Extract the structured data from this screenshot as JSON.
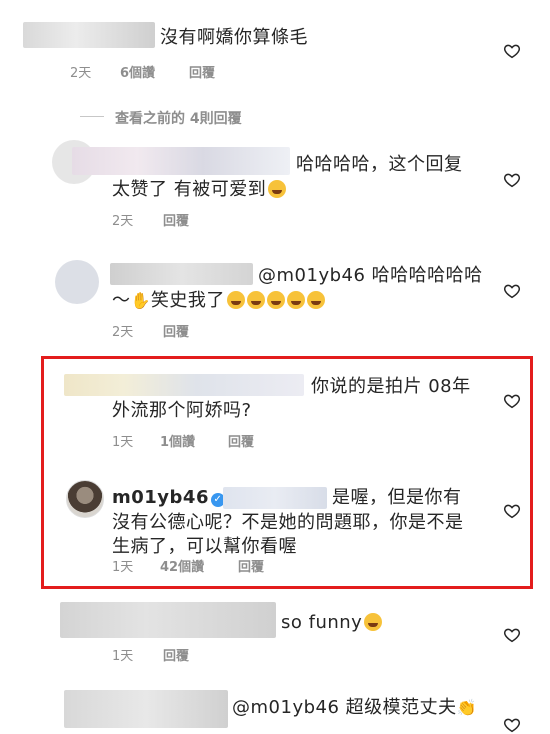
{
  "comments": [
    {
      "text": "沒有啊嬌你算條毛",
      "time": "2天",
      "likes": "6個讚",
      "reply": "回覆"
    },
    {
      "view_prev": "查看之前的 4則回覆"
    },
    {
      "text_l1": "哈哈哈哈，这个回复",
      "text_l2": "太赞了 有被可爱到",
      "time": "2天",
      "reply": "回覆"
    },
    {
      "mention": "@m01yb46",
      "text_l1": "哈哈哈哈哈哈",
      "text_l2_a": "～",
      "text_l2_b": "笑史我了",
      "time": "2天",
      "reply": "回覆"
    },
    {
      "text_l1": "你说的是拍片 08年",
      "text_l2": "外流那个阿娇吗?",
      "time": "1天",
      "likes": "1個讚",
      "reply": "回覆"
    },
    {
      "username": "m01yb46",
      "text_l1": "是喔，但是你有",
      "text_l2": "沒有公德心呢？不是她的問題耶，你是不是",
      "text_l3": "生病了，可以幫你看喔",
      "time": "1天",
      "likes": "42個讚",
      "reply": "回覆"
    },
    {
      "text": "so funny",
      "time": "1天",
      "reply": "回覆"
    },
    {
      "mention": "@m01yb46",
      "text": "超级模范丈夫"
    }
  ],
  "icons": {
    "like": "heart-outline-icon",
    "verified": "verified-badge-icon"
  },
  "colors": {
    "highlight_border": "#e31c1c",
    "meta_text": "#8e8e8e",
    "verified": "#3897f0"
  }
}
